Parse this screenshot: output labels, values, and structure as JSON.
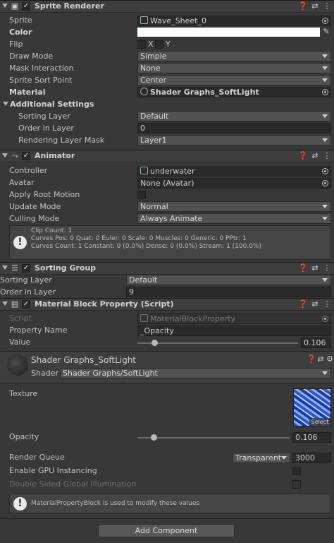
{
  "sprite_renderer": {
    "title": "Sprite Renderer",
    "sprite_label": "Sprite",
    "sprite_value": "Wave_Sheet_0",
    "color_label": "Color",
    "flip_label": "Flip",
    "flip_x": "X",
    "flip_y": "Y",
    "draw_mode_label": "Draw Mode",
    "draw_mode_value": "Simple",
    "mask_label": "Mask Interaction",
    "mask_value": "None",
    "sort_point_label": "Sprite Sort Point",
    "sort_point_value": "Center",
    "material_label": "Material",
    "material_value": "Shader Graphs_SoftLight",
    "additional_label": "Additional Settings",
    "sorting_layer_label": "Sorting Layer",
    "sorting_layer_value": "Default",
    "order_label": "Order in Layer",
    "order_value": "0",
    "rendering_mask_label": "Rendering Layer Mask",
    "rendering_mask_value": "Layer1"
  },
  "animator": {
    "title": "Animator",
    "controller_label": "Controller",
    "controller_value": "underwater",
    "avatar_label": "Avatar",
    "avatar_value": "None (Avatar)",
    "root_motion_label": "Apply Root Motion",
    "update_mode_label": "Update Mode",
    "update_mode_value": "Normal",
    "culling_label": "Culling Mode",
    "culling_value": "Always Animate",
    "info_line1": "Clip Count: 1",
    "info_line2": "Curves Pos: 0 Quat: 0 Euler: 0 Scale: 0 Muscles: 0 Generic: 0 PPtr: 1",
    "info_line3": "Curves Count: 1 Constant: 0 (0.0%) Dense: 0 (0.0%) Stream: 1 (100.0%)"
  },
  "sorting_group": {
    "title": "Sorting Group",
    "layer_label": "Sorting Layer",
    "layer_value": "Default",
    "order_label": "Order in Layer",
    "order_value": "9"
  },
  "mbp": {
    "title": "Material Block Property (Script)",
    "script_label": "Script",
    "script_value": "MaterialBlockProperty",
    "prop_label": "Property Name",
    "prop_value": "_Opacity",
    "value_label": "Value",
    "value_value": "0.106",
    "value_level": 0.106
  },
  "material": {
    "title": "Shader Graphs_SoftLight",
    "shader_label": "Shader",
    "shader_value": "Shader Graphs/SoftLight",
    "texture_label": "Texture",
    "select_label": "Select",
    "opacity_label": "Opacity",
    "opacity_value": "0.106",
    "opacity_level": 0.106,
    "queue_label": "Render Queue",
    "queue_mode": "Transparent",
    "queue_value": "3000",
    "gpu_label": "Enable GPU Instancing",
    "dsgi_label": "Double Sided Global Illumination",
    "info": "MaterialPropertyBlock is used to modify these values"
  },
  "add_component_label": "Add Component",
  "colors": {
    "background": "#383838",
    "header": "#3e3e3e",
    "field": "#2a2a2a",
    "dropdown": "#515151"
  }
}
